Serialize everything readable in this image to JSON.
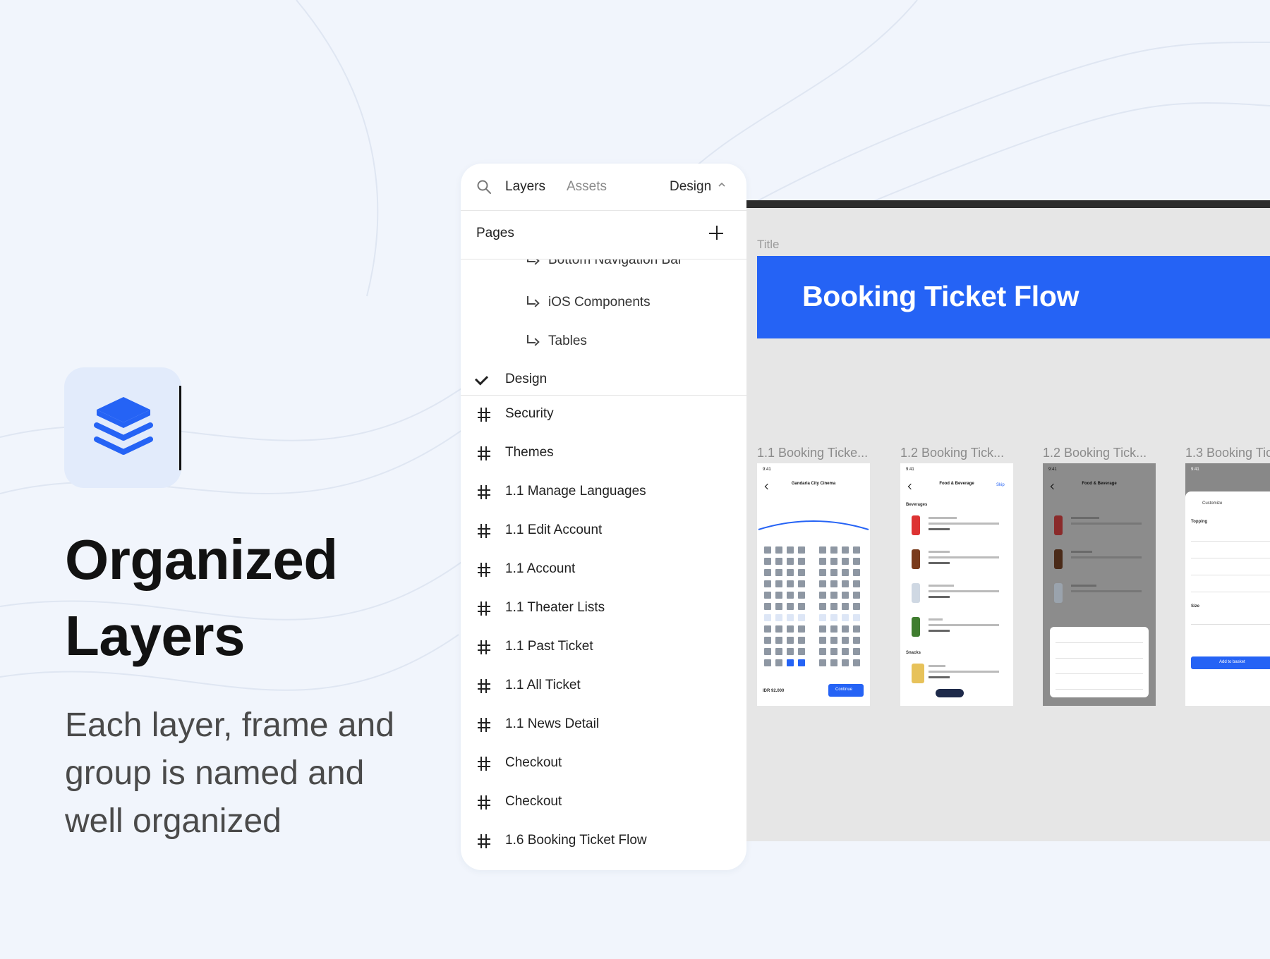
{
  "feature": {
    "icon": "layers-stack-icon",
    "heading_line1": "Organized",
    "heading_line2": "Layers",
    "sub_line1": "Each layer, frame and",
    "sub_line2": "group is named and",
    "sub_line3": "well organized"
  },
  "panel": {
    "tabs": {
      "layers": "Layers",
      "assets": "Assets",
      "design": "Design"
    },
    "pages_label": "Pages",
    "pages": [
      {
        "label": "Bottom Navigation Bar"
      },
      {
        "label": "iOS Components"
      },
      {
        "label": "Tables"
      },
      {
        "label": "Design",
        "selected": true
      }
    ],
    "frames": [
      "Security",
      "Themes",
      "1.1 Manage Languages",
      "1.1 Edit Account",
      "1.1 Account",
      "1.1 Theater Lists",
      "1.1 Past Ticket",
      "1.1 All Ticket",
      "1.1 News Detail",
      "Checkout",
      "Checkout",
      "1.6 Booking Ticket Flow"
    ]
  },
  "canvas": {
    "title_label": "Title",
    "banner_title": "Booking Ticket Flow",
    "frame_labels": [
      "1.1 Booking Ticke...",
      "1.2 Booking Tick...",
      "1.2 Booking Tick...",
      "1.3 Booking Tic"
    ],
    "screen1": {
      "time": "9:41",
      "cinema": "Gandaria City Cinema",
      "price": "IDR 92.000",
      "button": "Continue"
    },
    "screen2": {
      "time": "9:41",
      "title": "Food & Beverage",
      "skip": "Skip",
      "section1": "Beverages",
      "section2": "Snacks"
    },
    "screen3": {
      "time": "9:41",
      "title": "Food & Beverage"
    },
    "screen4": {
      "time": "9:41",
      "title": "Customize",
      "topping": "Topping",
      "size": "Size",
      "button": "Add to basket"
    }
  },
  "colors": {
    "accent": "#2563f5",
    "background": "#f1f5fc",
    "icon_tile": "#e2ebfb"
  }
}
